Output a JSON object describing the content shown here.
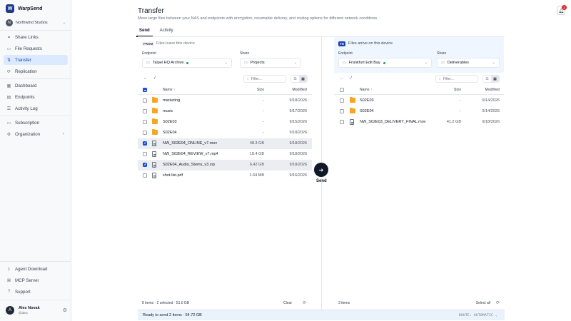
{
  "app": {
    "name": "WarpSend",
    "logo_letter": "W"
  },
  "org": {
    "name": "Northwind Studios",
    "avatar": "N"
  },
  "nav": {
    "items": [
      {
        "label": "Share Links",
        "icon": "share-icon"
      },
      {
        "label": "File Requests",
        "icon": "file-request-icon"
      },
      {
        "label": "Transfer",
        "icon": "transfer-icon",
        "active": true
      },
      {
        "label": "Replication",
        "icon": "replication-icon"
      },
      {
        "label": "Dashboard",
        "icon": "dashboard-icon"
      },
      {
        "label": "Endpoints",
        "icon": "endpoints-icon"
      },
      {
        "label": "Activity Log",
        "icon": "activity-icon"
      },
      {
        "label": "Subscription",
        "icon": "subscription-icon"
      },
      {
        "label": "Organization",
        "icon": "organization-icon"
      }
    ],
    "bottom": [
      {
        "label": "Agent Download",
        "icon": "download-icon"
      },
      {
        "label": "MCP Server",
        "icon": "server-icon"
      },
      {
        "label": "Support",
        "icon": "support-icon"
      }
    ]
  },
  "user": {
    "name": "Alex Novak",
    "handle": "@alex",
    "avatar": "A"
  },
  "header": {
    "title": "Transfer",
    "subtitle": "Move large files between your NAS and endpoints with encryption, resumable delivery, and routing options for different network conditions.",
    "notifications": "2",
    "tabs": [
      "Send",
      "Activity"
    ]
  },
  "source": {
    "badge": "FROM",
    "desc": "Files leave this device",
    "endpoint_label": "Endpoint",
    "endpoint": "Taipei HQ Archive",
    "share_label": "Share",
    "share": "Projects",
    "path": "/",
    "filter_placeholder": "Filter...",
    "columns": {
      "name": "Name ↑",
      "size": "Size",
      "modified": "Modified"
    },
    "rows": [
      {
        "name": "marketing",
        "type": "folder",
        "size": "-",
        "modified": "9/18/2026",
        "selected": false
      },
      {
        "name": "music",
        "type": "folder",
        "size": "-",
        "modified": "9/17/2026",
        "selected": false
      },
      {
        "name": "S02E03",
        "type": "folder",
        "size": "-",
        "modified": "9/15/2026",
        "selected": false
      },
      {
        "name": "S02E04",
        "type": "folder",
        "size": "-",
        "modified": "9/18/2026",
        "selected": false
      },
      {
        "name": "NW_S02E04_ONLINE_v7.mov",
        "type": "file",
        "size": "48.3 GB",
        "modified": "9/18/2026",
        "selected": true
      },
      {
        "name": "NW_S02E04_REVIEW_v7.mp4",
        "type": "file",
        "size": "18.4 GB",
        "modified": "9/18/2026",
        "selected": false
      },
      {
        "name": "S02E04_Audio_Stems_v3.zip",
        "type": "file",
        "size": "6.42 GB",
        "modified": "9/18/2026",
        "selected": true
      },
      {
        "name": "shot-list.pdf",
        "type": "file",
        "size": "1.64 MB",
        "modified": "9/16/2026",
        "selected": false
      }
    ],
    "footer": "8 items · 2 selected · 51.0 GB",
    "clear": "Clear"
  },
  "destination": {
    "badge": "TO",
    "desc": "Files arrive on this device",
    "endpoint_label": "Endpoint",
    "endpoint": "Frankfurt Edit Bay",
    "share_label": "Share",
    "share": "Deliverables",
    "path": "/",
    "filter_placeholder": "Filter...",
    "columns": {
      "name": "Name ↑",
      "size": "Size",
      "modified": "Modified"
    },
    "rows": [
      {
        "name": "S02E03",
        "type": "folder",
        "size": "-",
        "modified": "9/14/2026"
      },
      {
        "name": "S02E04",
        "type": "folder",
        "size": "-",
        "modified": "9/14/2026"
      },
      {
        "name": "NW_S02E03_DELIVERY_FINAL.mov",
        "type": "file",
        "size": "41.2 GB",
        "modified": "9/18/2026"
      }
    ],
    "footer": "3 items",
    "select_all": "Select all"
  },
  "send": {
    "label": "Send"
  },
  "status": {
    "text": "Ready to send 2 items · 54.72 GB",
    "route": "ROUTE: AUTOMATIC ⌄"
  },
  "colors": {
    "accent": "#1d4ed8",
    "active_nav": "#dbeafe",
    "folder": "#f6a623",
    "online": "#16a34a"
  }
}
